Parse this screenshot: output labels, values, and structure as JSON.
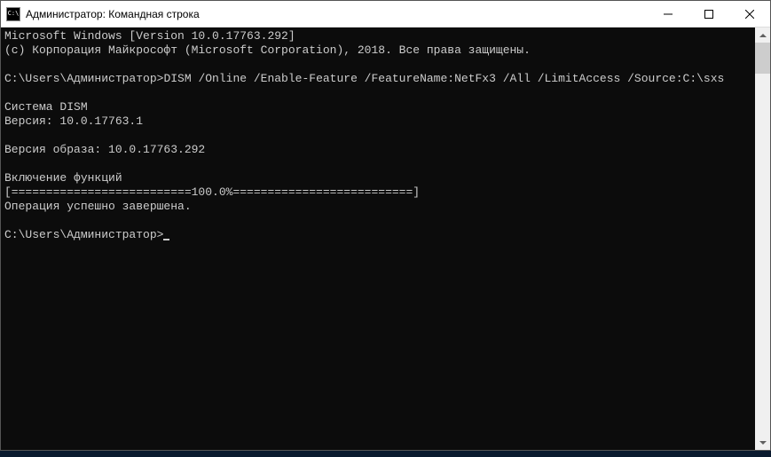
{
  "titlebar": {
    "icon_text": "C:\\",
    "title": "Администратор: Командная строка"
  },
  "terminal": {
    "line1": "Microsoft Windows [Version 10.0.17763.292]",
    "line2": "(c) Корпорация Майкрософт (Microsoft Corporation), 2018. Все права защищены.",
    "blank1": "",
    "prompt1": "C:\\Users\\Администратор>",
    "command1": "DISM /Online /Enable-Feature /FeatureName:NetFx3 /All /LimitAccess /Source:C:\\sxs",
    "blank2": "",
    "dism1": "Cистема DISM",
    "dism2": "Версия: 10.0.17763.1",
    "blank3": "",
    "image_version": "Версия образа: 10.0.17763.292",
    "blank4": "",
    "enabling": "Включение функций",
    "progress": "[==========================100.0%==========================]",
    "success": "Операция успешно завершена.",
    "blank5": "",
    "prompt2": "C:\\Users\\Администратор>"
  }
}
